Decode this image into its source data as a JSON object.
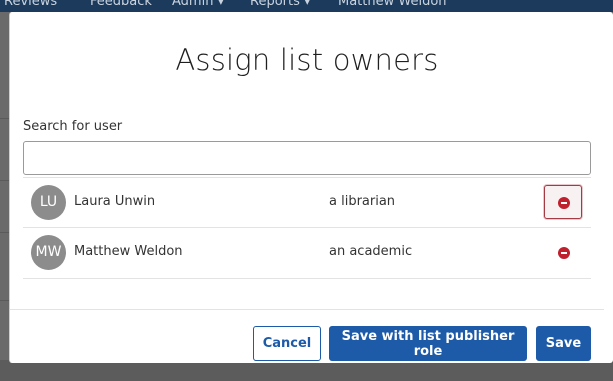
{
  "background_nav": {
    "items": [
      "Reviews",
      "Feedback",
      "Admin ▾",
      "Reports ▾",
      "Matthew Weldon"
    ]
  },
  "modal": {
    "title": "Assign list owners",
    "search": {
      "label": "Search for user",
      "value": "",
      "placeholder": ""
    },
    "users": [
      {
        "initials": "LU",
        "name": "Laura Unwin",
        "role": "a librarian"
      },
      {
        "initials": "MW",
        "name": "Matthew Weldon",
        "role": "an academic"
      }
    ],
    "buttons": {
      "cancel": "Cancel",
      "save_with_publisher": "Save with list publisher role",
      "save": "Save"
    }
  },
  "colors": {
    "primary": "#1d5aa8",
    "remove": "#c0202e",
    "avatar": "#8c8c8c",
    "overlay": "#6a6a6a"
  }
}
